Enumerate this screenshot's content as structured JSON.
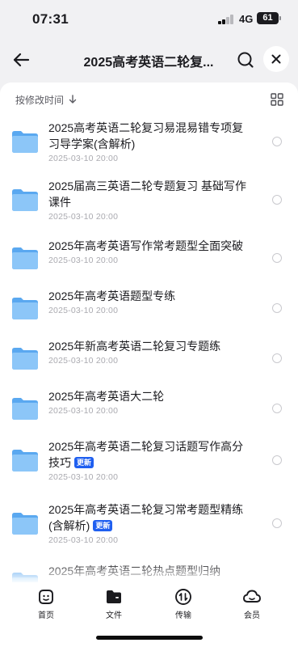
{
  "status_bar": {
    "time": "07:31",
    "network": "4G",
    "battery": "61"
  },
  "nav": {
    "title": "2025高考英语二轮复..."
  },
  "sort": {
    "label": "按修改时间"
  },
  "files": [
    {
      "name": "2025高考英语二轮复习易混易错专项复习导学案(含解析)",
      "date": "2025-03-10 20:00",
      "badge": ""
    },
    {
      "name": "2025届高三英语二轮专题复习 基础写作课件",
      "date": "2025-03-10 20:00",
      "badge": ""
    },
    {
      "name": "2025年高考英语写作常考题型全面突破",
      "date": "2025-03-10 20:00",
      "badge": ""
    },
    {
      "name": "2025年高考英语题型专练",
      "date": "2025-03-10 20:00",
      "badge": ""
    },
    {
      "name": "2025年新高考英语二轮复习专题练",
      "date": "2025-03-10 20:00",
      "badge": ""
    },
    {
      "name": "2025年高考英语大二轮",
      "date": "2025-03-10 20:00",
      "badge": ""
    },
    {
      "name": "2025年高考英语二轮复习话题写作高分技巧",
      "date": "2025-03-10 20:00",
      "badge": "更新"
    },
    {
      "name": "2025年高考英语二轮复习常考题型精练(含解析)",
      "date": "2025-03-10 20:00",
      "badge": "更新"
    },
    {
      "name": "2025年高考英语二轮热点题型归纳",
      "date": "",
      "badge": ""
    }
  ],
  "tabs": [
    {
      "label": "首页",
      "icon": "home-face-icon"
    },
    {
      "label": "文件",
      "icon": "folder-tab-icon"
    },
    {
      "label": "传输",
      "icon": "transfer-icon"
    },
    {
      "label": "会员",
      "icon": "cloud-icon"
    }
  ],
  "colors": {
    "accent": "#1f5ff0",
    "folder": "#5aa8f0",
    "background": "#f1f1f3"
  }
}
